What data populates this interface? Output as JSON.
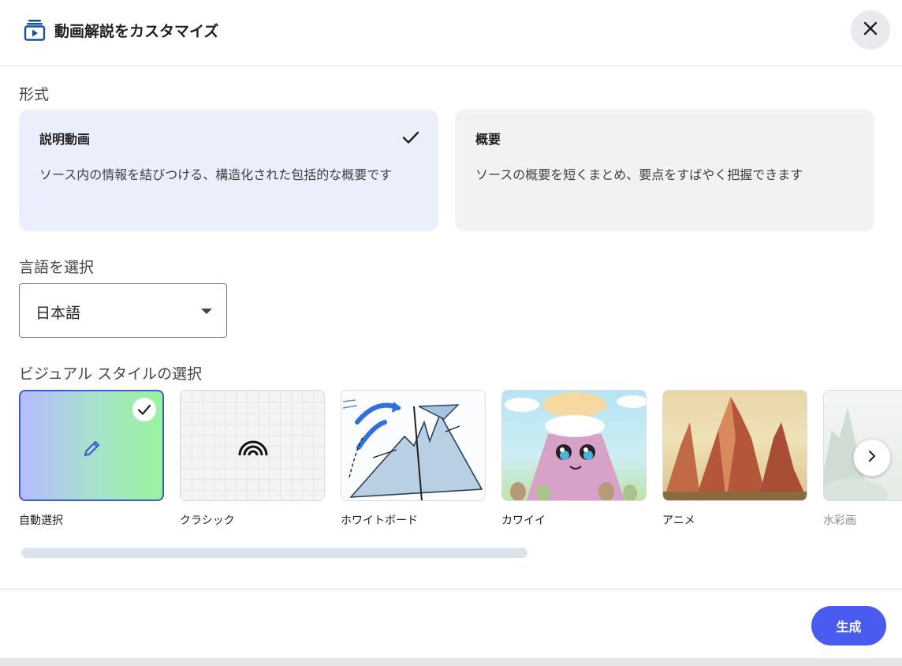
{
  "dialog": {
    "title": "動画解説をカスタマイズ",
    "close_icon": "close-icon"
  },
  "format": {
    "label": "形式",
    "options": [
      {
        "title": "説明動画",
        "description": "ソース内の情報を結びつける、構造化された包括的な概要です",
        "selected": true
      },
      {
        "title": "概要",
        "description": "ソースの概要を短くまとめ、要点をすばやく把握できます",
        "selected": false
      }
    ]
  },
  "language": {
    "label": "言語を選択",
    "selected": "日本語"
  },
  "visual_style": {
    "label": "ビジュアル スタイルの選択",
    "options": [
      {
        "label": "自動選択",
        "selected": true
      },
      {
        "label": "クラシック",
        "selected": false
      },
      {
        "label": "ホワイトボード",
        "selected": false
      },
      {
        "label": "カワイイ",
        "selected": false
      },
      {
        "label": "アニメ",
        "selected": false
      },
      {
        "label": "水彩画",
        "selected": false
      }
    ]
  },
  "footer": {
    "generate_label": "生成"
  },
  "colors": {
    "accent": "#4a5bef",
    "selected_card": "#ebeffb",
    "unselected_card": "#f1f2f3"
  }
}
